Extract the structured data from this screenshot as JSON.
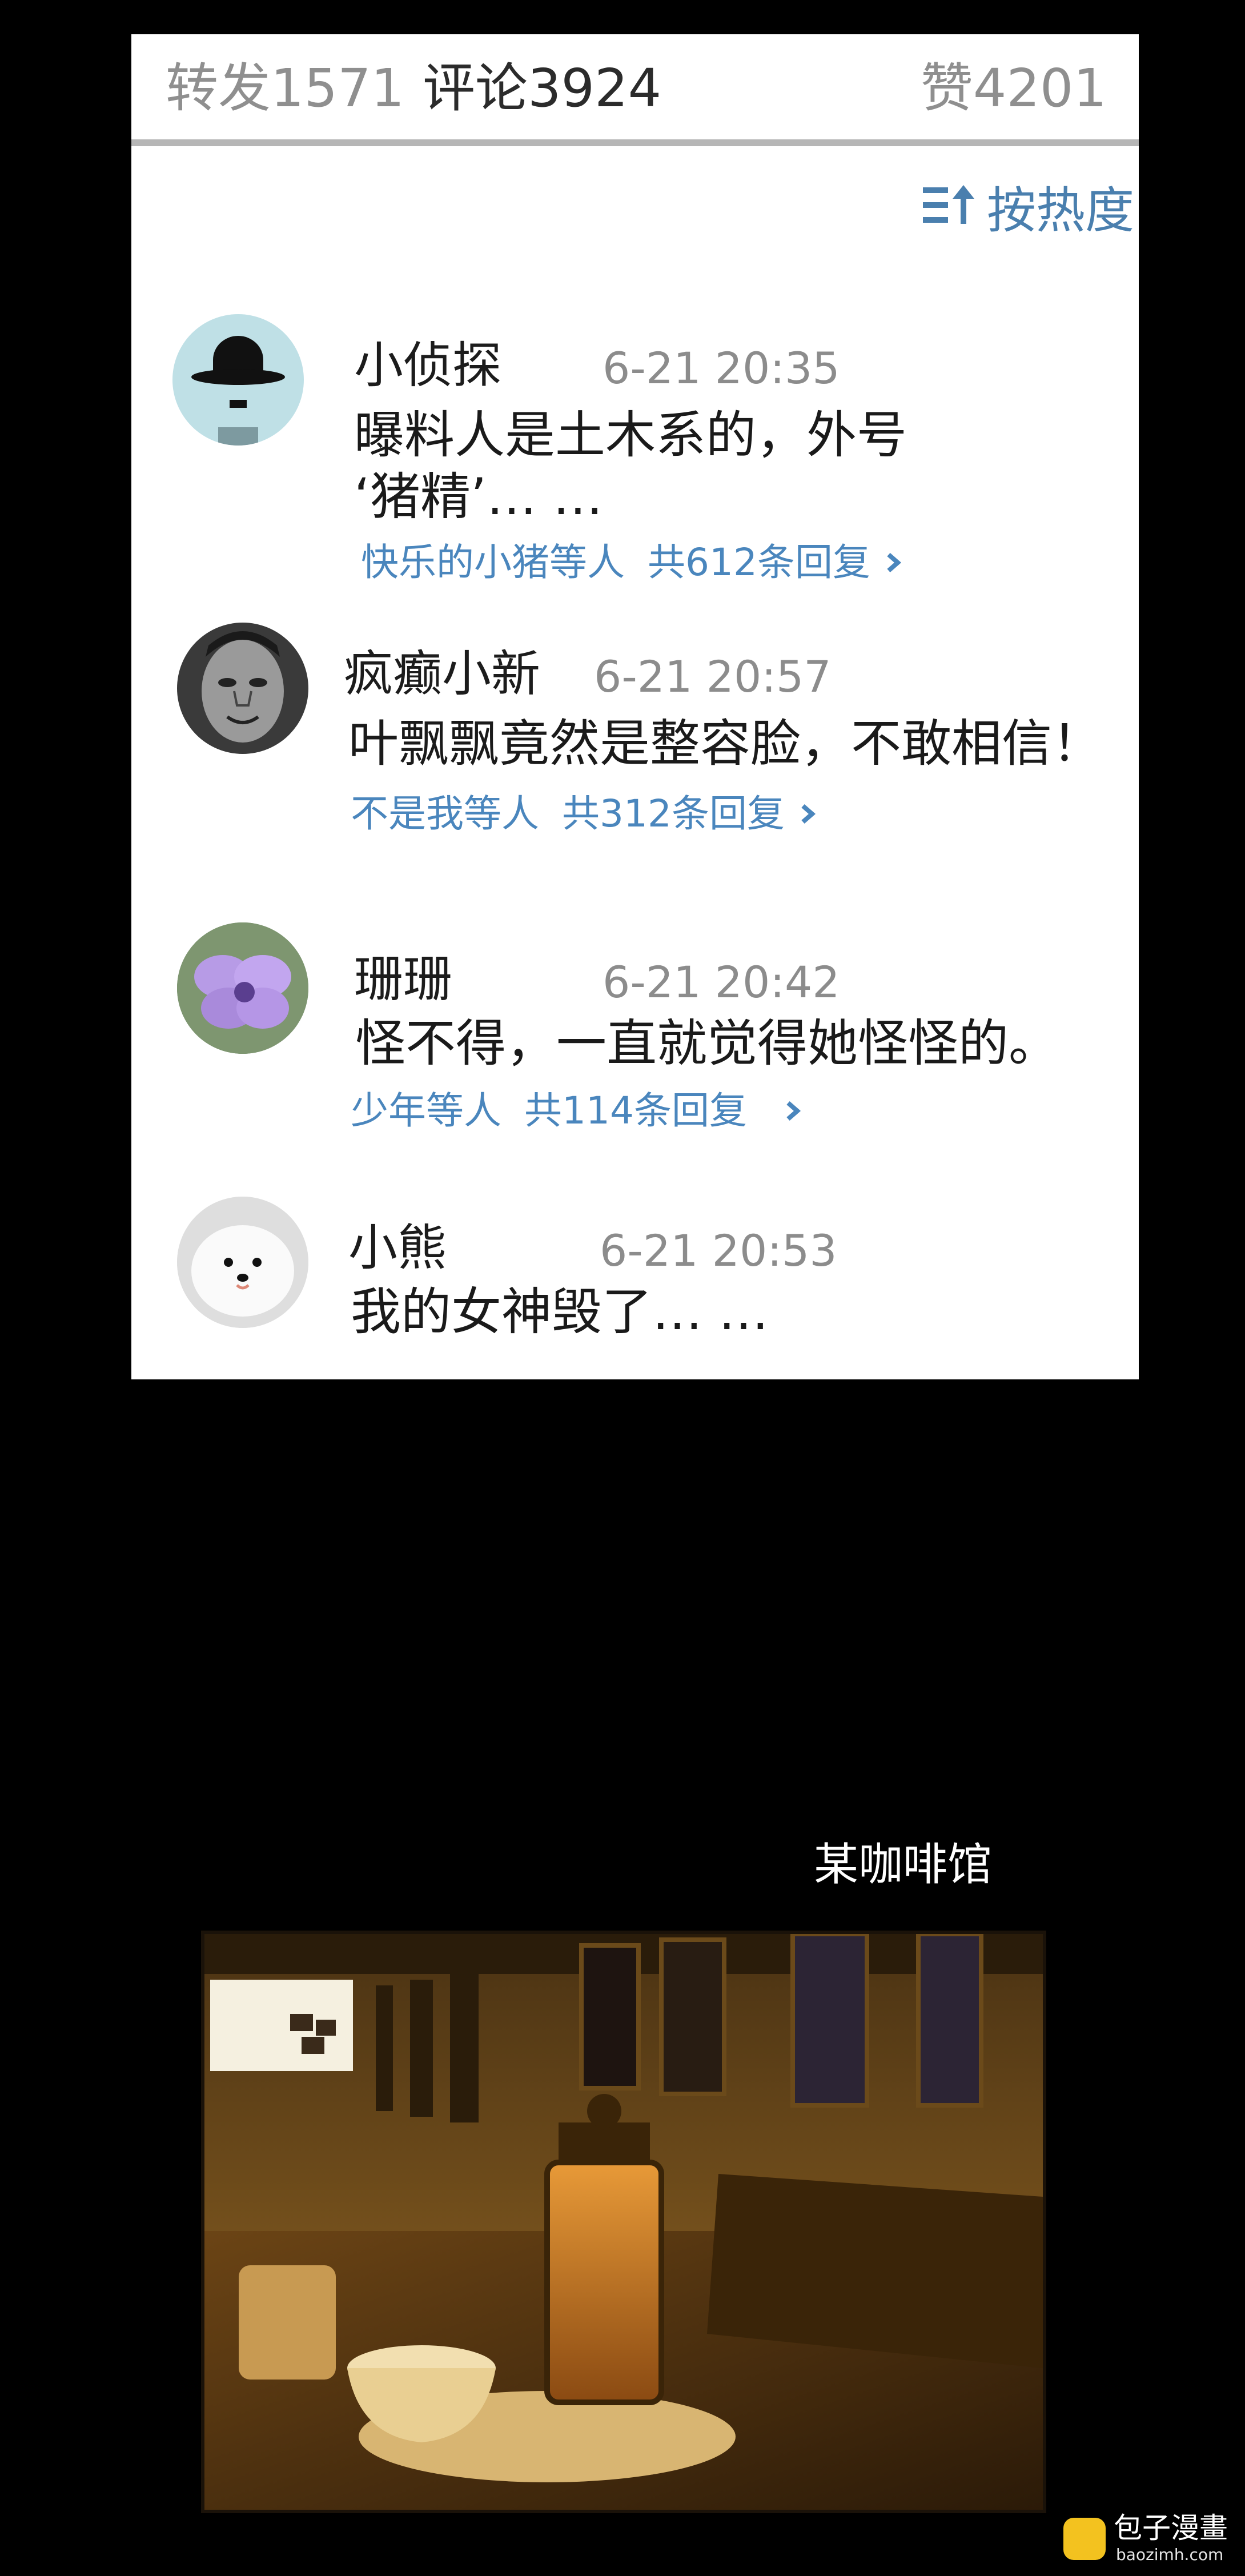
{
  "stats": {
    "repost": "转发1571",
    "comments": "评论3924",
    "likes": "赞4201"
  },
  "sort": {
    "label": "按热度",
    "icon": "sort-hot-icon"
  },
  "comments": [
    {
      "username": "小侦探",
      "time": "6-21  20:35",
      "text_lines": [
        "曝料人是土木系的，外号",
        "‘猪精’… …"
      ],
      "replies": {
        "by": "快乐的小猪等人",
        "count": "共612条回复"
      },
      "avatar": "bowler-hat-avatar"
    },
    {
      "username": "疯癫小新",
      "time": "6-21  20:57",
      "text_lines": [
        "叶飘飘竟然是整容脸，不敢相信！"
      ],
      "replies": {
        "by": "不是我等人",
        "count": "共312条回复"
      },
      "avatar": "meme-face-avatar"
    },
    {
      "username": "珊珊",
      "time": "6-21  20:42",
      "text_lines": [
        "怪不得，一直就觉得她怪怪的。"
      ],
      "replies": {
        "by": "少年等人",
        "count": "共114条回复"
      },
      "avatar": "purple-flower-avatar"
    },
    {
      "username": "小熊",
      "time": "6-21  20:53",
      "text_lines": [
        "我的女神毁了… …"
      ],
      "avatar": "dog-avatar"
    }
  ],
  "caption": "某咖啡馆",
  "watermark": {
    "title": "包子漫畫",
    "url": "baozimh.com"
  },
  "colors": {
    "accent": "#4a86bd",
    "panel": "#ffffff",
    "background": "#000000",
    "watermark": "#f3c21f"
  }
}
